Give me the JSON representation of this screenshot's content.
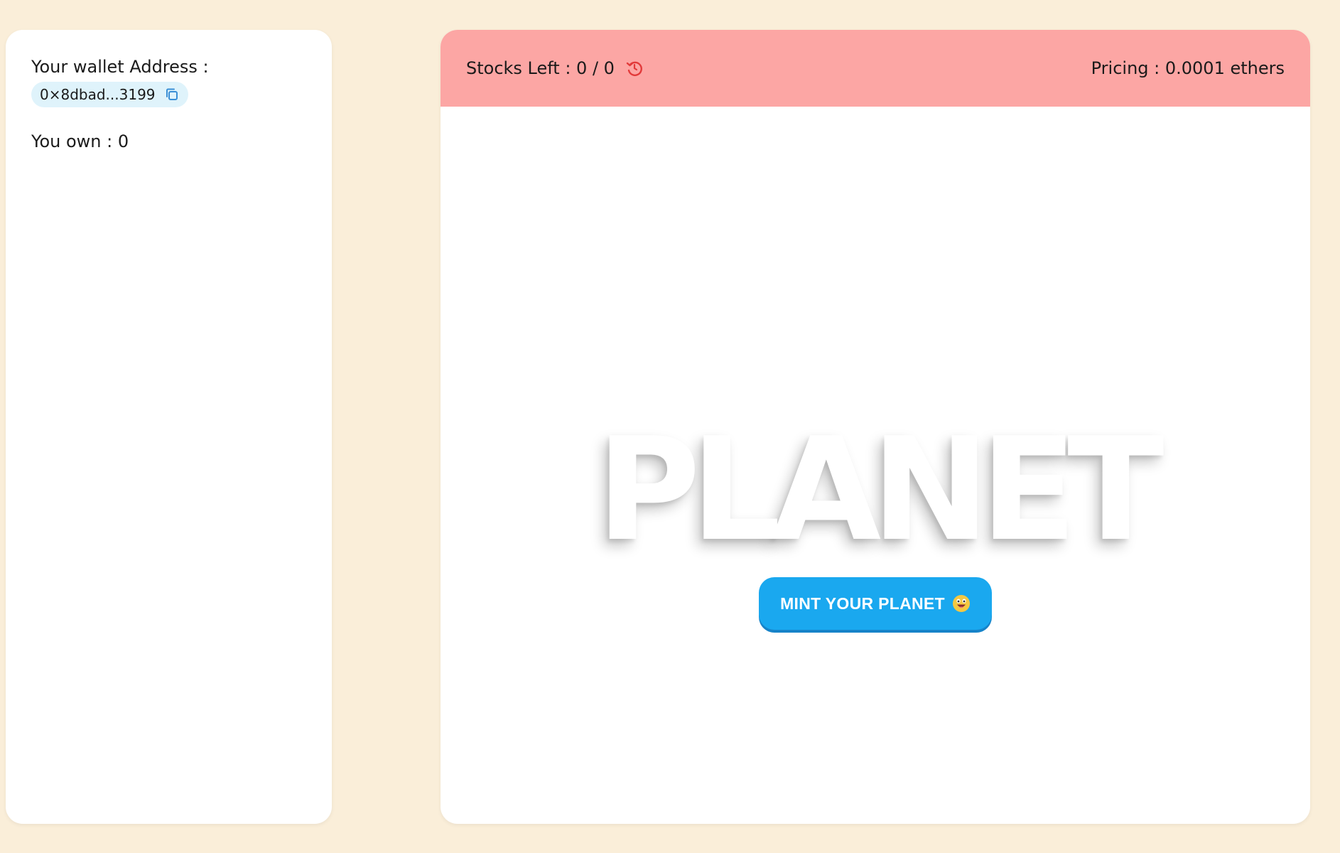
{
  "wallet": {
    "label": "Your wallet Address :",
    "address": "0×8dbad...3199",
    "copy_icon": "copy-icon",
    "own_label": "You own : 0"
  },
  "header": {
    "stocks_label": "Stocks Left : 0 / 0",
    "refresh_icon": "refresh-icon",
    "pricing_label": "Pricing : 0.0001 ethers",
    "bg_color": "#fca6a4"
  },
  "hero": {
    "title": "PLANET",
    "mint_label": "MINT YOUR PLANET",
    "emoji_icon": "grinning-face-icon",
    "button_color": "#1aa8ef"
  },
  "colors": {
    "page_bg": "#faeed9",
    "chip_bg": "#dff3fb",
    "accent_red": "#e23a3a"
  }
}
